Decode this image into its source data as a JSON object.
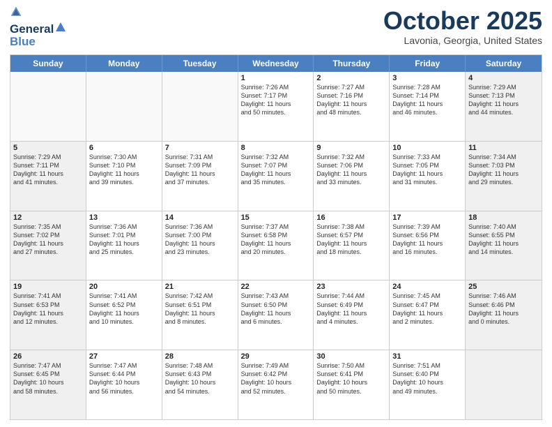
{
  "header": {
    "logo_line1": "General",
    "logo_line2": "Blue",
    "month": "October 2025",
    "location": "Lavonia, Georgia, United States"
  },
  "weekdays": [
    "Sunday",
    "Monday",
    "Tuesday",
    "Wednesday",
    "Thursday",
    "Friday",
    "Saturday"
  ],
  "rows": [
    [
      {
        "day": "",
        "text": "",
        "empty": true
      },
      {
        "day": "",
        "text": "",
        "empty": true
      },
      {
        "day": "",
        "text": "",
        "empty": true
      },
      {
        "day": "1",
        "text": "Sunrise: 7:26 AM\nSunset: 7:17 PM\nDaylight: 11 hours\nand 50 minutes.",
        "empty": false
      },
      {
        "day": "2",
        "text": "Sunrise: 7:27 AM\nSunset: 7:16 PM\nDaylight: 11 hours\nand 48 minutes.",
        "empty": false
      },
      {
        "day": "3",
        "text": "Sunrise: 7:28 AM\nSunset: 7:14 PM\nDaylight: 11 hours\nand 46 minutes.",
        "empty": false
      },
      {
        "day": "4",
        "text": "Sunrise: 7:29 AM\nSunset: 7:13 PM\nDaylight: 11 hours\nand 44 minutes.",
        "empty": false,
        "shaded": true
      }
    ],
    [
      {
        "day": "5",
        "text": "Sunrise: 7:29 AM\nSunset: 7:11 PM\nDaylight: 11 hours\nand 41 minutes.",
        "shaded": true
      },
      {
        "day": "6",
        "text": "Sunrise: 7:30 AM\nSunset: 7:10 PM\nDaylight: 11 hours\nand 39 minutes."
      },
      {
        "day": "7",
        "text": "Sunrise: 7:31 AM\nSunset: 7:09 PM\nDaylight: 11 hours\nand 37 minutes."
      },
      {
        "day": "8",
        "text": "Sunrise: 7:32 AM\nSunset: 7:07 PM\nDaylight: 11 hours\nand 35 minutes."
      },
      {
        "day": "9",
        "text": "Sunrise: 7:32 AM\nSunset: 7:06 PM\nDaylight: 11 hours\nand 33 minutes."
      },
      {
        "day": "10",
        "text": "Sunrise: 7:33 AM\nSunset: 7:05 PM\nDaylight: 11 hours\nand 31 minutes."
      },
      {
        "day": "11",
        "text": "Sunrise: 7:34 AM\nSunset: 7:03 PM\nDaylight: 11 hours\nand 29 minutes.",
        "shaded": true
      }
    ],
    [
      {
        "day": "12",
        "text": "Sunrise: 7:35 AM\nSunset: 7:02 PM\nDaylight: 11 hours\nand 27 minutes.",
        "shaded": true
      },
      {
        "day": "13",
        "text": "Sunrise: 7:36 AM\nSunset: 7:01 PM\nDaylight: 11 hours\nand 25 minutes."
      },
      {
        "day": "14",
        "text": "Sunrise: 7:36 AM\nSunset: 7:00 PM\nDaylight: 11 hours\nand 23 minutes."
      },
      {
        "day": "15",
        "text": "Sunrise: 7:37 AM\nSunset: 6:58 PM\nDaylight: 11 hours\nand 20 minutes."
      },
      {
        "day": "16",
        "text": "Sunrise: 7:38 AM\nSunset: 6:57 PM\nDaylight: 11 hours\nand 18 minutes."
      },
      {
        "day": "17",
        "text": "Sunrise: 7:39 AM\nSunset: 6:56 PM\nDaylight: 11 hours\nand 16 minutes."
      },
      {
        "day": "18",
        "text": "Sunrise: 7:40 AM\nSunset: 6:55 PM\nDaylight: 11 hours\nand 14 minutes.",
        "shaded": true
      }
    ],
    [
      {
        "day": "19",
        "text": "Sunrise: 7:41 AM\nSunset: 6:53 PM\nDaylight: 11 hours\nand 12 minutes.",
        "shaded": true
      },
      {
        "day": "20",
        "text": "Sunrise: 7:41 AM\nSunset: 6:52 PM\nDaylight: 11 hours\nand 10 minutes."
      },
      {
        "day": "21",
        "text": "Sunrise: 7:42 AM\nSunset: 6:51 PM\nDaylight: 11 hours\nand 8 minutes."
      },
      {
        "day": "22",
        "text": "Sunrise: 7:43 AM\nSunset: 6:50 PM\nDaylight: 11 hours\nand 6 minutes."
      },
      {
        "day": "23",
        "text": "Sunrise: 7:44 AM\nSunset: 6:49 PM\nDaylight: 11 hours\nand 4 minutes."
      },
      {
        "day": "24",
        "text": "Sunrise: 7:45 AM\nSunset: 6:47 PM\nDaylight: 11 hours\nand 2 minutes."
      },
      {
        "day": "25",
        "text": "Sunrise: 7:46 AM\nSunset: 6:46 PM\nDaylight: 11 hours\nand 0 minutes.",
        "shaded": true
      }
    ],
    [
      {
        "day": "26",
        "text": "Sunrise: 7:47 AM\nSunset: 6:45 PM\nDaylight: 10 hours\nand 58 minutes.",
        "shaded": true
      },
      {
        "day": "27",
        "text": "Sunrise: 7:47 AM\nSunset: 6:44 PM\nDaylight: 10 hours\nand 56 minutes."
      },
      {
        "day": "28",
        "text": "Sunrise: 7:48 AM\nSunset: 6:43 PM\nDaylight: 10 hours\nand 54 minutes."
      },
      {
        "day": "29",
        "text": "Sunrise: 7:49 AM\nSunset: 6:42 PM\nDaylight: 10 hours\nand 52 minutes."
      },
      {
        "day": "30",
        "text": "Sunrise: 7:50 AM\nSunset: 6:41 PM\nDaylight: 10 hours\nand 50 minutes."
      },
      {
        "day": "31",
        "text": "Sunrise: 7:51 AM\nSunset: 6:40 PM\nDaylight: 10 hours\nand 49 minutes."
      },
      {
        "day": "",
        "text": "",
        "empty": true,
        "shaded": true
      }
    ]
  ]
}
